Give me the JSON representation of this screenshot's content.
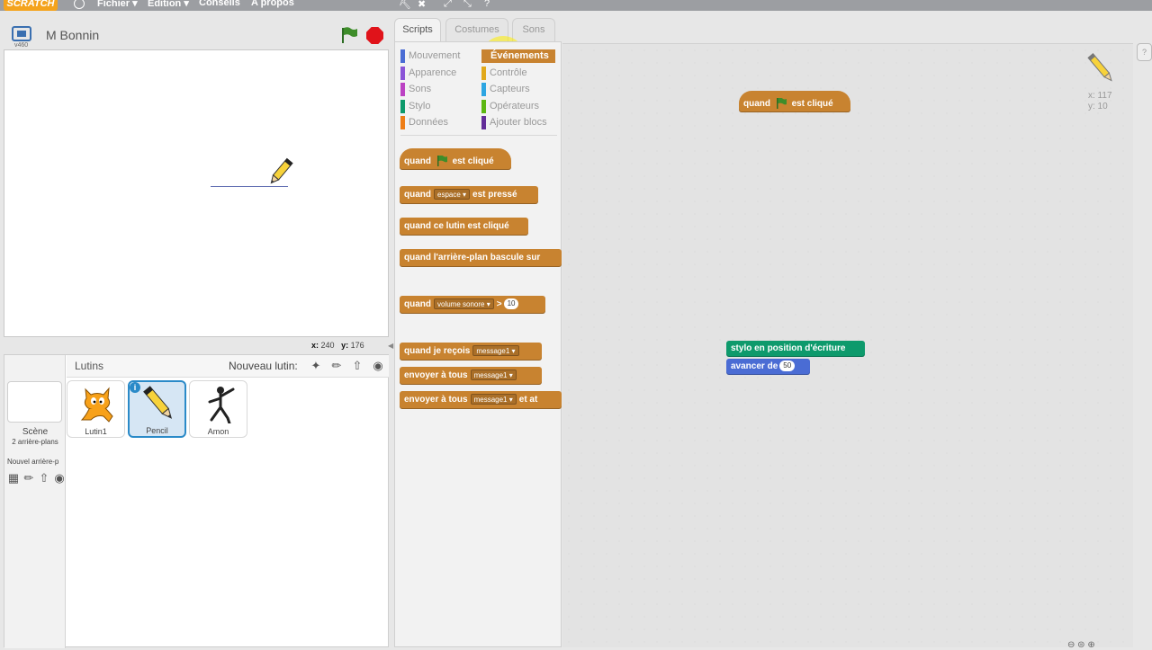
{
  "menubar": {
    "logo": "SCRATCH",
    "menus": [
      "Fichier ▾",
      "Edition ▾",
      "Conseils",
      "A propos"
    ]
  },
  "stage": {
    "version": "v460",
    "project_title": "M Bonnin",
    "x_label": "x:",
    "x_value": "240",
    "y_label": "y:",
    "y_value": "176"
  },
  "sprites": {
    "header_label": "Lutins",
    "new_sprite_label": "Nouveau lutin:",
    "scene_name": "Scène",
    "scene_sub": "2 arrière-plans",
    "new_backdrop_label": "Nouvel arrière-p",
    "items": [
      {
        "name": "Lutin1"
      },
      {
        "name": "Pencil"
      },
      {
        "name": "Amon"
      }
    ]
  },
  "tabs": {
    "scripts": "Scripts",
    "costumes": "Costumes",
    "sounds": "Sons"
  },
  "categories": [
    {
      "label": "Mouvement",
      "color": "#4a6cd4"
    },
    {
      "label": "Apparence",
      "color": "#8a55d7"
    },
    {
      "label": "Sons",
      "color": "#bb42c3"
    },
    {
      "label": "Stylo",
      "color": "#0e9a6c"
    },
    {
      "label": "Données",
      "color": "#ee7d16"
    },
    {
      "label": "Événements",
      "color": "#c88330"
    },
    {
      "label": "Contrôle",
      "color": "#e1a91a"
    },
    {
      "label": "Capteurs",
      "color": "#2ca5e2"
    },
    {
      "label": "Opérateurs",
      "color": "#5cb712"
    },
    {
      "label": "Ajouter blocs",
      "color": "#632d99"
    }
  ],
  "palette_blocks": {
    "flag_clicked_pre": "quand",
    "flag_clicked_post": "est cliqué",
    "key_pressed_pre": "quand",
    "key_pressed_key": "espace",
    "key_pressed_post": "est pressé",
    "sprite_clicked": "quand ce lutin est cliqué",
    "backdrop_switch": "quand l'arrière-plan bascule sur",
    "sensor_pre": "quand",
    "sensor_dd": "volume sonore",
    "sensor_op": ">",
    "sensor_value": "10",
    "receive_pre": "quand je reçois",
    "receive_msg": "message1",
    "broadcast_pre": "envoyer à tous",
    "broadcast_msg": "message1",
    "broadcast_wait_pre": "envoyer à tous",
    "broadcast_wait_msg": "message1",
    "broadcast_wait_post": "et at"
  },
  "script_blocks": {
    "hat_pre": "quand",
    "hat_post": "est cliqué",
    "pen_down": "stylo en position d'écriture",
    "move_pre": "avancer de",
    "move_value": "50"
  },
  "sprite_position": {
    "x": "x: 117",
    "y": "y: 10"
  },
  "help_label": "?"
}
